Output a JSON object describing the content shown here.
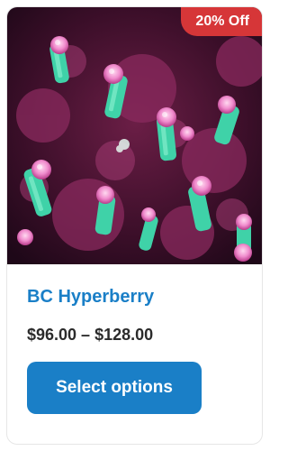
{
  "product": {
    "title": "BC Hyperberry",
    "price": "$96.00 – $128.00",
    "badge": "20% Off",
    "button_label": "Select options"
  },
  "colors": {
    "title": "#1a7fc7",
    "button": "#1a7fc7",
    "badge": "#d63638",
    "price": "#2b2b2b"
  }
}
